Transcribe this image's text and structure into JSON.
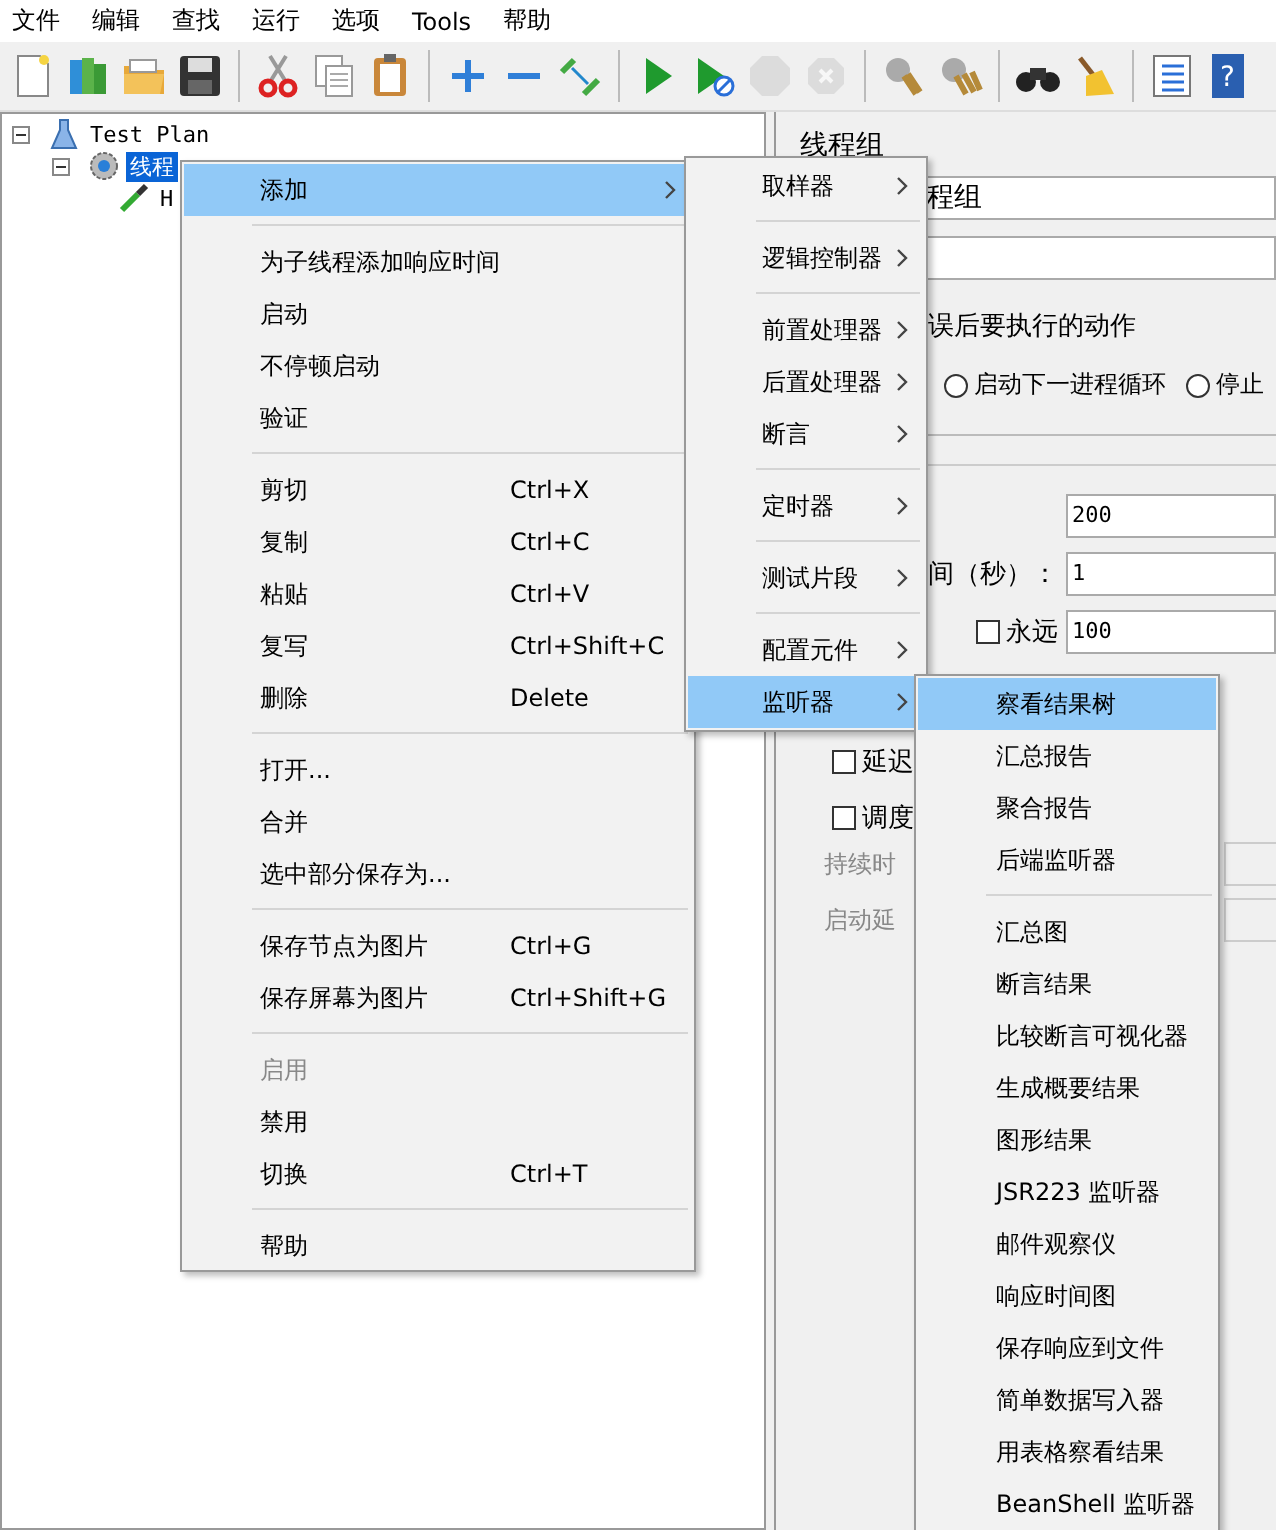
{
  "menu_bar": [
    "文件",
    "编辑",
    "查找",
    "运行",
    "选项",
    "Tools",
    "帮助"
  ],
  "toolbar": [
    {
      "kind": "new",
      "disabled": false
    },
    {
      "kind": "templates",
      "disabled": false
    },
    {
      "kind": "open",
      "disabled": false
    },
    {
      "kind": "save",
      "disabled": false
    },
    {
      "kind": "separator"
    },
    {
      "kind": "cut",
      "disabled": false
    },
    {
      "kind": "copy",
      "disabled": false
    },
    {
      "kind": "paste",
      "disabled": false
    },
    {
      "kind": "separator"
    },
    {
      "kind": "expand",
      "disabled": false
    },
    {
      "kind": "collapse",
      "disabled": false
    },
    {
      "kind": "toggle",
      "disabled": false
    },
    {
      "kind": "separator"
    },
    {
      "kind": "start",
      "disabled": false
    },
    {
      "kind": "start-no-pauses",
      "disabled": false
    },
    {
      "kind": "stop",
      "disabled": true
    },
    {
      "kind": "shutdown",
      "disabled": true
    },
    {
      "kind": "separator"
    },
    {
      "kind": "clear",
      "disabled": false
    },
    {
      "kind": "clear-all",
      "disabled": false
    },
    {
      "kind": "separator"
    },
    {
      "kind": "search",
      "disabled": false
    },
    {
      "kind": "reset-search",
      "disabled": false
    },
    {
      "kind": "separator"
    },
    {
      "kind": "function-helper",
      "disabled": false
    },
    {
      "kind": "help",
      "disabled": false,
      "glyph": "?"
    }
  ],
  "tree": [
    {
      "label": "Test Plan",
      "kind": "plan",
      "selected": false,
      "expanded": true,
      "children": [
        {
          "label": "线程",
          "kind": "thread-group",
          "selected": true,
          "expanded": true,
          "children": [
            {
              "label": "H",
              "kind": "sampler",
              "selected": false
            }
          ]
        }
      ]
    }
  ],
  "panel": {
    "title": "线程组",
    "name_value": "程组",
    "error_action": {
      "legend": "误后要执行的动作",
      "options": [
        {
          "label": "启动下一进程循环",
          "selected": false
        },
        {
          "label": "停止",
          "selected": false
        }
      ]
    },
    "thread_count": "200",
    "ramp_up": {
      "label": "间（秒）：",
      "value": "1"
    },
    "loop": {
      "label": "永远",
      "checked": false,
      "value": "100"
    },
    "options": [
      {
        "label": "延迟",
        "checked": false
      },
      {
        "label": "调度",
        "checked": false
      }
    ],
    "duration_label": "持续时",
    "delay_label": "启动延"
  },
  "context_menu": [
    {
      "kind": "item",
      "label": "添加",
      "submenu": true,
      "selected": true,
      "disabled": false
    },
    {
      "kind": "separator"
    },
    {
      "kind": "item",
      "label": "为子线程添加响应时间",
      "selected": false,
      "disabled": false
    },
    {
      "kind": "item",
      "label": "启动",
      "selected": false,
      "disabled": false
    },
    {
      "kind": "item",
      "label": "不停顿启动",
      "selected": false,
      "disabled": false
    },
    {
      "kind": "item",
      "label": "验证",
      "selected": false,
      "disabled": false
    },
    {
      "kind": "separator"
    },
    {
      "kind": "item",
      "label": "剪切",
      "shortcut": "Ctrl+X",
      "selected": false,
      "disabled": false
    },
    {
      "kind": "item",
      "label": "复制",
      "shortcut": "Ctrl+C",
      "selected": false,
      "disabled": false
    },
    {
      "kind": "item",
      "label": "粘贴",
      "shortcut": "Ctrl+V",
      "selected": false,
      "disabled": false
    },
    {
      "kind": "item",
      "label": "复写",
      "shortcut": "Ctrl+Shift+C",
      "selected": false,
      "disabled": false
    },
    {
      "kind": "item",
      "label": "删除",
      "shortcut": "Delete",
      "selected": false,
      "disabled": false
    },
    {
      "kind": "separator"
    },
    {
      "kind": "item",
      "label": "打开...",
      "selected": false,
      "disabled": false
    },
    {
      "kind": "item",
      "label": "合并",
      "selected": false,
      "disabled": false
    },
    {
      "kind": "item",
      "label": "选中部分保存为...",
      "selected": false,
      "disabled": false
    },
    {
      "kind": "separator"
    },
    {
      "kind": "item",
      "label": "保存节点为图片",
      "shortcut": "Ctrl+G",
      "selected": false,
      "disabled": false
    },
    {
      "kind": "item",
      "label": "保存屏幕为图片",
      "shortcut": "Ctrl+Shift+G",
      "selected": false,
      "disabled": false
    },
    {
      "kind": "separator"
    },
    {
      "kind": "item",
      "label": "启用",
      "selected": false,
      "disabled": true
    },
    {
      "kind": "item",
      "label": "禁用",
      "selected": false,
      "disabled": false
    },
    {
      "kind": "item",
      "label": "切换",
      "shortcut": "Ctrl+T",
      "selected": false,
      "disabled": false
    },
    {
      "kind": "separator"
    },
    {
      "kind": "item",
      "label": "帮助",
      "selected": false,
      "disabled": false
    }
  ],
  "add_submenu": [
    {
      "kind": "item",
      "label": "取样器",
      "submenu": true,
      "selected": false
    },
    {
      "kind": "separator"
    },
    {
      "kind": "item",
      "label": "逻辑控制器",
      "submenu": true,
      "selected": false
    },
    {
      "kind": "separator"
    },
    {
      "kind": "item",
      "label": "前置处理器",
      "submenu": true,
      "selected": false
    },
    {
      "kind": "item",
      "label": "后置处理器",
      "submenu": true,
      "selected": false
    },
    {
      "kind": "item",
      "label": "断言",
      "submenu": true,
      "selected": false
    },
    {
      "kind": "separator"
    },
    {
      "kind": "item",
      "label": "定时器",
      "submenu": true,
      "selected": false
    },
    {
      "kind": "separator"
    },
    {
      "kind": "item",
      "label": "测试片段",
      "submenu": true,
      "selected": false
    },
    {
      "kind": "separator"
    },
    {
      "kind": "item",
      "label": "配置元件",
      "submenu": true,
      "selected": false
    },
    {
      "kind": "item",
      "label": "监听器",
      "submenu": true,
      "selected": true
    }
  ],
  "listener_submenu": [
    {
      "kind": "item",
      "label": "察看结果树",
      "selected": true
    },
    {
      "kind": "item",
      "label": "汇总报告",
      "selected": false
    },
    {
      "kind": "item",
      "label": "聚合报告",
      "selected": false
    },
    {
      "kind": "item",
      "label": "后端监听器",
      "selected": false
    },
    {
      "kind": "separator"
    },
    {
      "kind": "item",
      "label": "汇总图",
      "selected": false
    },
    {
      "kind": "item",
      "label": "断言结果",
      "selected": false
    },
    {
      "kind": "item",
      "label": "比较断言可视化器",
      "selected": false
    },
    {
      "kind": "item",
      "label": "生成概要结果",
      "selected": false
    },
    {
      "kind": "item",
      "label": "图形结果",
      "selected": false
    },
    {
      "kind": "item",
      "label": "JSR223 监听器",
      "selected": false
    },
    {
      "kind": "item",
      "label": "邮件观察仪",
      "selected": false
    },
    {
      "kind": "item",
      "label": "响应时间图",
      "selected": false
    },
    {
      "kind": "item",
      "label": "保存响应到文件",
      "selected": false
    },
    {
      "kind": "item",
      "label": "简单数据写入器",
      "selected": false
    },
    {
      "kind": "item",
      "label": "用表格察看结果",
      "selected": false
    },
    {
      "kind": "item",
      "label": "BeanShell 监听器",
      "selected": false
    }
  ]
}
